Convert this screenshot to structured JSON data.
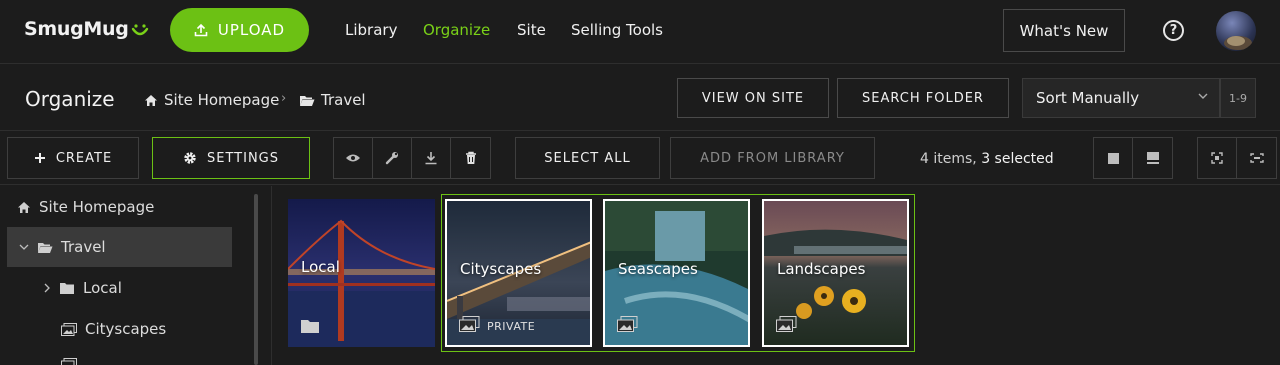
{
  "app": {
    "logo": "SmugMug"
  },
  "topnav": {
    "upload_label": "UPLOAD",
    "links": [
      "Library",
      "Organize",
      "Site",
      "Selling Tools"
    ],
    "active": "Organize",
    "whats_new": "What's New",
    "help_glyph": "?"
  },
  "header": {
    "title": "Organize",
    "breadcrumb": [
      "Site Homepage",
      "Travel"
    ],
    "view_on_site": "VIEW ON SITE",
    "search_folder": "SEARCH FOLDER",
    "sort_value": "Sort Manually",
    "range": "1-9"
  },
  "toolbar": {
    "create": "CREATE",
    "settings": "SETTINGS",
    "select_all": "SELECT ALL",
    "add_from_library": "ADD FROM LIBRARY",
    "items_count": "4 items,",
    "selected_count": "3 selected"
  },
  "sidebar": {
    "items": [
      "Site Homepage",
      "Travel",
      "Local",
      "Cityscapes"
    ]
  },
  "tiles": [
    {
      "title": "Local",
      "type": "folder",
      "selected": false,
      "badge": ""
    },
    {
      "title": "Cityscapes",
      "type": "gallery",
      "selected": true,
      "badge": "PRIVATE"
    },
    {
      "title": "Seascapes",
      "type": "gallery",
      "selected": true,
      "badge": ""
    },
    {
      "title": "Landscapes",
      "type": "gallery",
      "selected": true,
      "badge": ""
    }
  ],
  "colors": {
    "accent": "#6cc114",
    "active_link": "#7ad118",
    "background": "#1c1c1c"
  }
}
